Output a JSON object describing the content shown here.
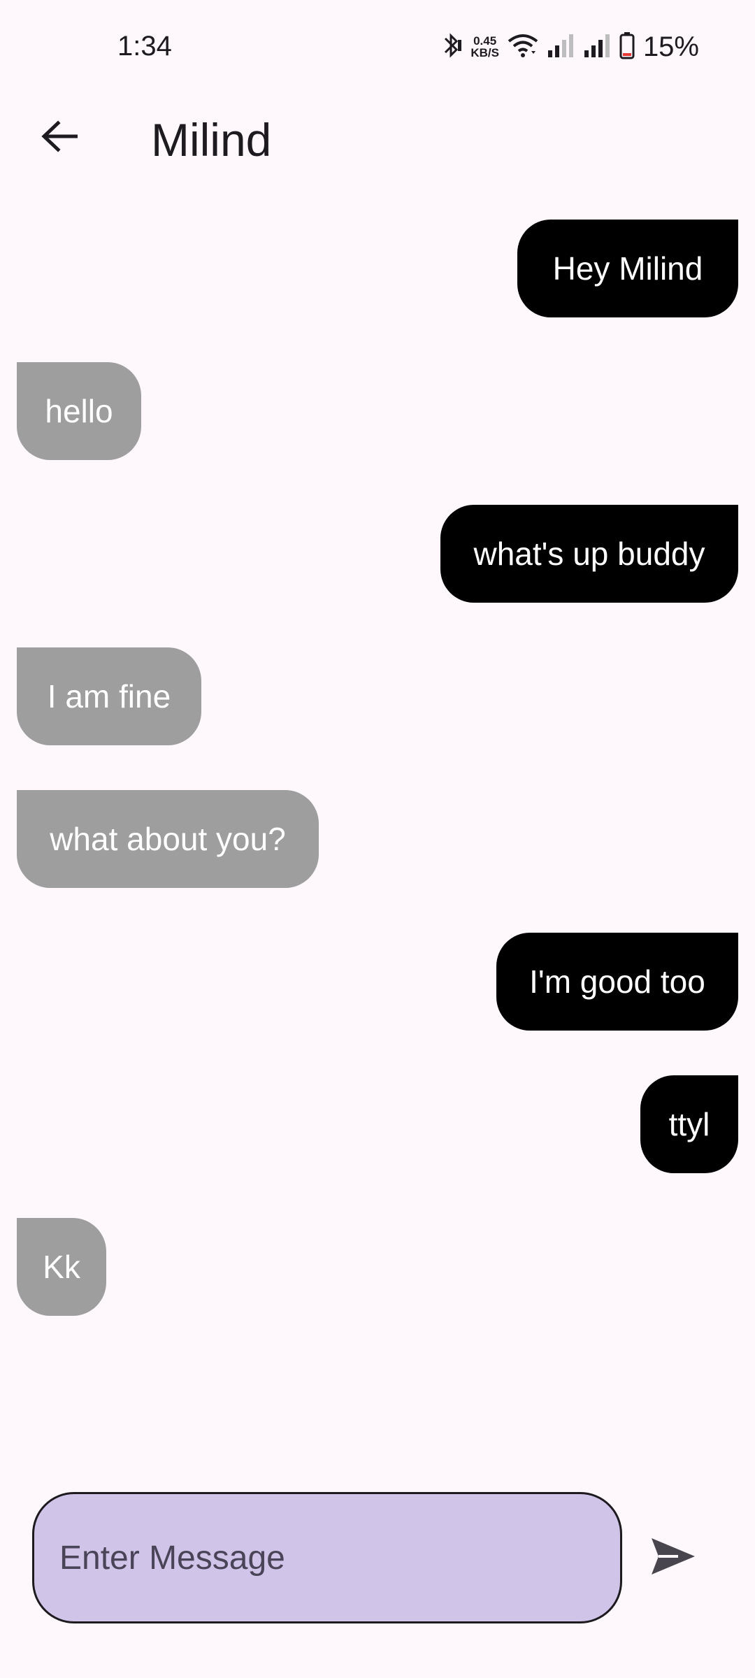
{
  "status_bar": {
    "time": "1:34",
    "net_speed_value": "0.45",
    "net_speed_unit": "KB/S",
    "battery": "15%"
  },
  "header": {
    "title": "Milind"
  },
  "messages": [
    {
      "text": "Hey Milind",
      "direction": "sent"
    },
    {
      "text": "hello",
      "direction": "received"
    },
    {
      "text": "what's up buddy",
      "direction": "sent"
    },
    {
      "text": "I am fine",
      "direction": "received"
    },
    {
      "text": "what about you?",
      "direction": "received"
    },
    {
      "text": "I'm good too",
      "direction": "sent"
    },
    {
      "text": "ttyl",
      "direction": "sent"
    },
    {
      "text": "Kk",
      "direction": "received"
    }
  ],
  "composer": {
    "placeholder": "Enter Message",
    "value": ""
  },
  "colors": {
    "background": "#fef7fb",
    "sent_bubble": "#000000",
    "received_bubble": "#9e9e9e",
    "input_fill": "#d0c4e8",
    "send_icon": "#49454f",
    "battery_low": "#e53935"
  }
}
